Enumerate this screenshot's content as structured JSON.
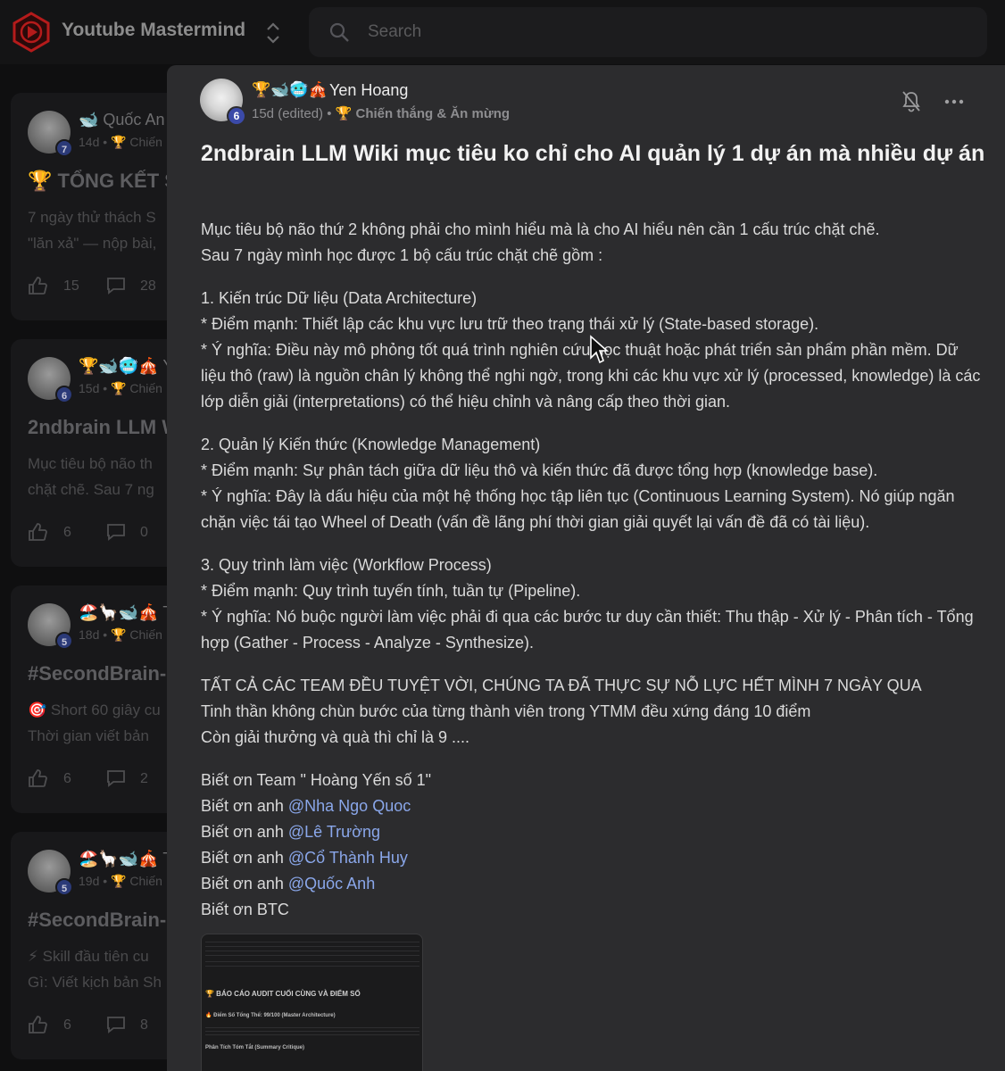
{
  "app": {
    "title": "Youtube Mastermind"
  },
  "search": {
    "placeholder": "Search"
  },
  "feed": [
    {
      "avatar_badge": "7",
      "name": "🐋 Quốc An",
      "meta": "14d • 🏆 Chiến",
      "title": "🏆 TỔNG KẾT S",
      "line1": "7 ngày thử thách S",
      "line2": "\"lăn xả\" — nộp bài,",
      "likes": "15",
      "comments": "28"
    },
    {
      "avatar_badge": "6",
      "name": "🏆🐋🥶🎪 Y",
      "meta": "15d • 🏆 Chiến",
      "title": "2ndbrain LLM W",
      "line1": "Mục tiêu bộ não th",
      "line2": "chặt chẽ. Sau 7 ng",
      "likes": "6",
      "comments": "0"
    },
    {
      "avatar_badge": "5",
      "name": "🏖️🦙🐋🎪 T",
      "meta": "18d • 🏆 Chiến",
      "title": "#SecondBrain-",
      "line1": "🎯 Short 60 giây cu",
      "line2": "Thời gian viết bản",
      "likes": "6",
      "comments": "2"
    },
    {
      "avatar_badge": "5",
      "name": "🏖️🦙🐋🎪 T",
      "meta": "19d • 🏆 Chiến",
      "title": "#SecondBrain-",
      "line1": "⚡ Skill đầu tiên cu",
      "line2": "Gì: Viết kịch bản Sh",
      "likes": "6",
      "comments": "8"
    }
  ],
  "post": {
    "author_emojis": "🏆🐋🥶🎪",
    "author": "Yen Hoang",
    "avatar_badge": "6",
    "time": "15d (edited)",
    "separator": "•",
    "category": "🏆 Chiến thắng & Ăn mừng",
    "title": "2ndbrain LLM Wiki mục tiêu ko chỉ cho AI quản lý 1 dự án mà nhiều dự án",
    "intro": [
      "Mục tiêu bộ não thứ 2 không phải cho mình hiểu mà là cho AI hiểu nên cần 1 cấu trúc chặt chẽ.",
      "Sau 7 ngày mình học được 1 bộ cấu trúc chặt chẽ gồm :"
    ],
    "sections": [
      {
        "heading": "1. Kiến trúc Dữ liệu (Data Architecture)",
        "strength": "* Điểm mạnh: Thiết lập các khu vực lưu trữ theo trạng thái xử lý (State-based storage).",
        "meaning": "* Ý nghĩa: Điều này mô phỏng tốt quá trình nghiên cứu học thuật hoặc phát triển sản phẩm phần mềm. Dữ liệu thô (raw) là nguồn chân lý không thể nghi ngờ, trong khi các khu vực xử lý (processed, knowledge) là các lớp diễn giải (interpretations) có thể hiệu chỉnh và nâng cấp theo thời gian."
      },
      {
        "heading": "2. Quản lý Kiến thức (Knowledge Management)",
        "strength": "* Điểm mạnh: Sự phân tách giữa dữ liệu thô và kiến thức đã được tổng hợp (knowledge base).",
        "meaning": "* Ý nghĩa: Đây là dấu hiệu của một hệ thống học tập liên tục (Continuous Learning System). Nó giúp ngăn chặn việc tái tạo Wheel of Death (vấn đề lãng phí thời gian giải quyết lại vấn đề đã có tài liệu)."
      },
      {
        "heading": "3. Quy trình làm việc (Workflow Process)",
        "strength": "* Điểm mạnh: Quy trình tuyến tính, tuần tự (Pipeline).",
        "meaning": "* Ý nghĩa: Nó buộc người làm việc phải đi qua các bước tư duy cần thiết: Thu thập - Xử lý - Phân tích - Tổng hợp (Gather - Process - Analyze - Synthesize)."
      }
    ],
    "closing": [
      "TẤT CẢ CÁC TEAM ĐỀU TUYỆT VỜI, CHÚNG TA ĐÃ THỰC SỰ NỖ LỰC HẾT MÌNH 7 NGÀY QUA",
      "Tinh thần không chùn bước của từng thành viên trong YTMM đều xứng đáng 10 điểm",
      "Còn giải thưởng và quà thì chỉ là 9 ...."
    ],
    "thanks_team": "Biết ơn Team \" Hoàng Yến số 1\"",
    "thanks_prefix": "Biết ơn anh ",
    "mentions": [
      "@Nha Ngo Quoc",
      "@Lê Trường",
      "@Cổ Thành Huy",
      "@Quốc Anh"
    ],
    "thanks_btc": "Biết ơn BTC",
    "attachment": {
      "heading": "🏆 BÁO CÁO AUDIT CUỐI CÙNG VÀ ĐIỂM SỐ",
      "score": "🔥 Điểm Số Tổng Thể: 99/100 (Master Architecture)",
      "summary": "Phân Tích Tóm Tắt (Summary Critique)"
    }
  },
  "colors": {
    "accent": "#3b4aa8",
    "mention": "#8aa7ea",
    "modal_bg": "#2c2c2e",
    "page_bg": "#0f0f10"
  }
}
